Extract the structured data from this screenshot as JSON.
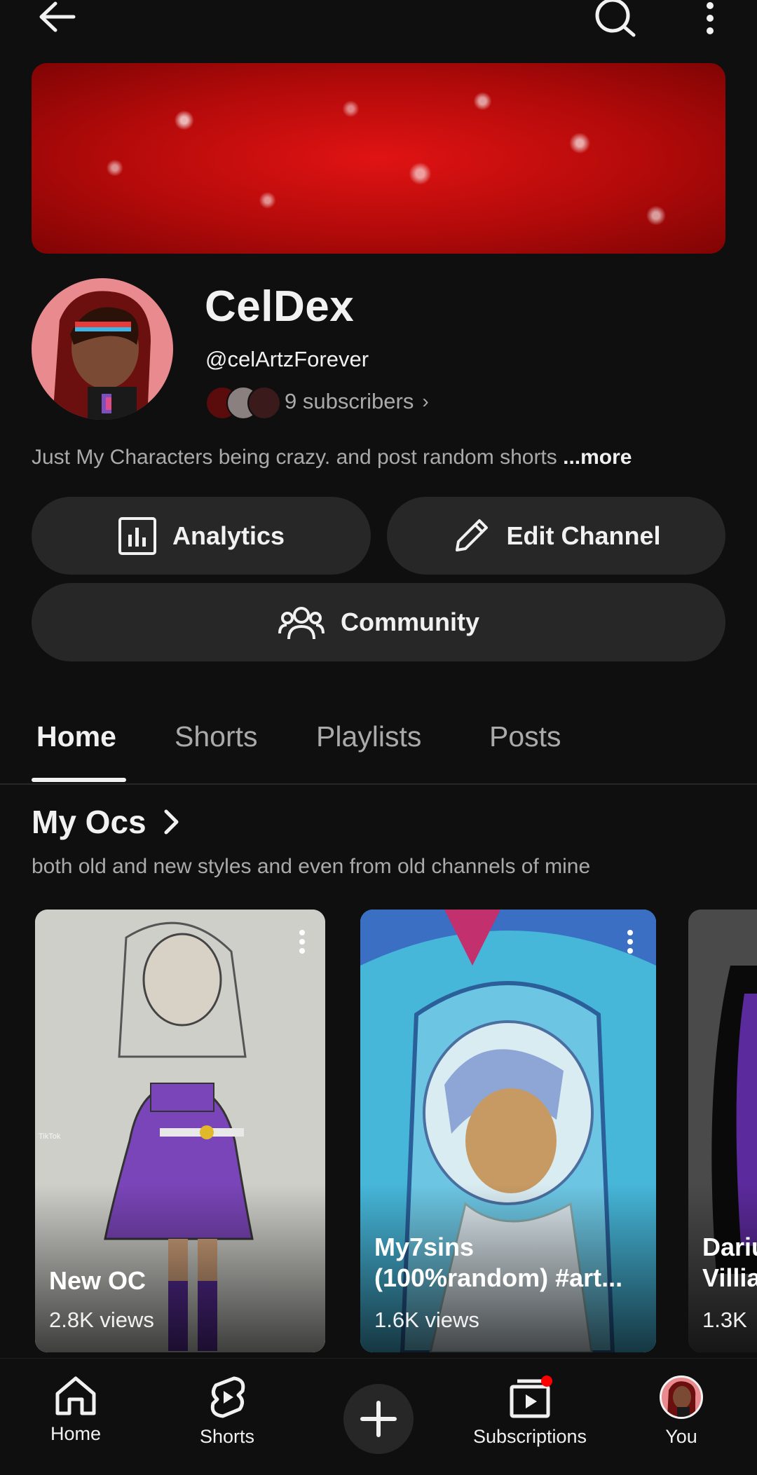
{
  "channel": {
    "name": "CelDex",
    "handle": "@celArtzForever",
    "subscribers": "9 subscribers",
    "description": "Just My Characters being crazy. and post random shorts",
    "description_more": "...more"
  },
  "actions": {
    "analytics": "Analytics",
    "edit_channel": "Edit Channel",
    "community": "Community"
  },
  "tabs": [
    {
      "label": "Home",
      "active": true
    },
    {
      "label": "Shorts",
      "active": false
    },
    {
      "label": "Playlists",
      "active": false
    },
    {
      "label": "Posts",
      "active": false
    }
  ],
  "section": {
    "title": "My Ocs",
    "subtitle": "both old and new styles and even from old channels of mine"
  },
  "shorts": [
    {
      "title": "New OC",
      "views": "2.8K views",
      "watermark": "TikTok"
    },
    {
      "title": "My7sins (100%random) #art...",
      "views": "1.6K views"
    },
    {
      "title": "Dariu Villia",
      "views": "1.3K"
    }
  ],
  "bottom_nav": {
    "home": "Home",
    "shorts": "Shorts",
    "subscriptions": "Subscriptions",
    "you": "You"
  },
  "icons": [
    "back-arrow-icon",
    "search-icon",
    "more-vert-icon",
    "analytics-icon",
    "pencil-icon",
    "community-icon",
    "chevron-right-icon",
    "home-icon",
    "shorts-icon",
    "create-plus-icon",
    "subscriptions-icon"
  ],
  "colors": {
    "accent": "#ff0000",
    "background": "#0f0f0f",
    "surface": "#272727"
  }
}
